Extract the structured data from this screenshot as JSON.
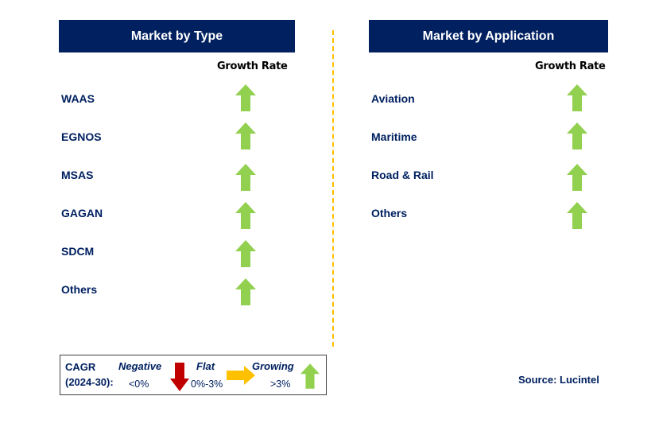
{
  "left_panel": {
    "title": "Market by Type",
    "column_header": "Growth Rate",
    "rows": [
      {
        "label": "WAAS",
        "trend": "growing"
      },
      {
        "label": "EGNOS",
        "trend": "growing"
      },
      {
        "label": "MSAS",
        "trend": "growing"
      },
      {
        "label": "GAGAN",
        "trend": "growing"
      },
      {
        "label": "SDCM",
        "trend": "growing"
      },
      {
        "label": "Others",
        "trend": "growing"
      }
    ]
  },
  "right_panel": {
    "title": "Market by Application",
    "column_header": "Growth Rate",
    "rows": [
      {
        "label": "Aviation",
        "trend": "growing"
      },
      {
        "label": "Maritime",
        "trend": "growing"
      },
      {
        "label": "Road & Rail",
        "trend": "growing"
      },
      {
        "label": "Others",
        "trend": "growing"
      }
    ]
  },
  "legend": {
    "cagr_label_line1": "CAGR",
    "cagr_label_line2": "(2024-30):",
    "negative": {
      "label": "Negative",
      "range": "<0%",
      "icon": "arrow-down-icon",
      "color": "#C00000"
    },
    "flat": {
      "label": "Flat",
      "range": "0%-3%",
      "icon": "arrow-right-icon",
      "color": "#FFC000"
    },
    "growing": {
      "label": "Growing",
      "range": ">3%",
      "icon": "arrow-up-icon",
      "color": "#92D050"
    }
  },
  "source": "Source: Lucintel",
  "colors": {
    "header_bg": "#002060",
    "label_text": "#002060",
    "divider": "#FFC000",
    "growing_arrow": "#92D050"
  }
}
